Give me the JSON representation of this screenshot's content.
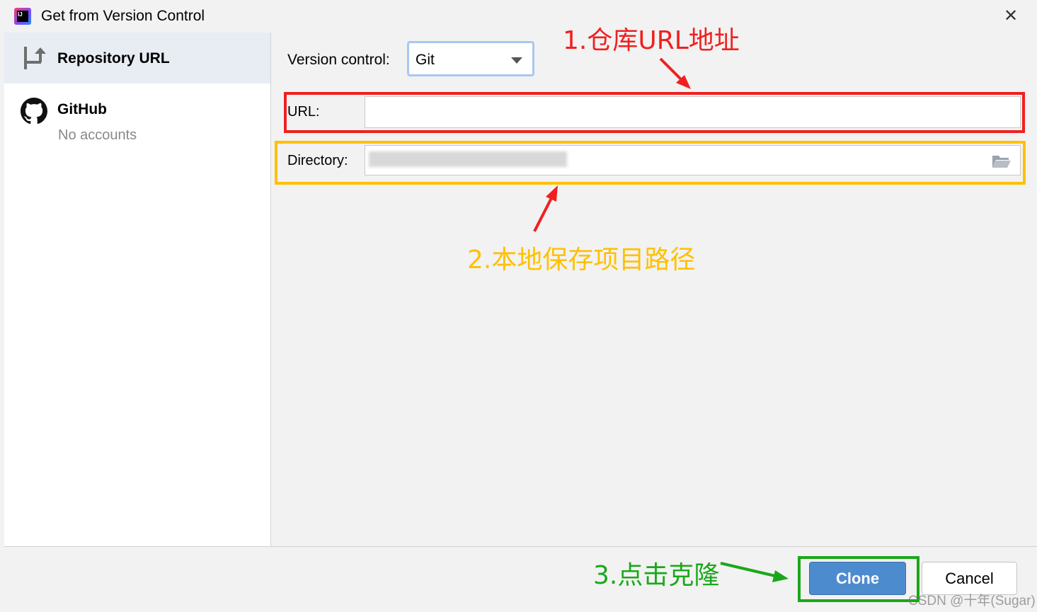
{
  "window": {
    "title": "Get from Version Control",
    "app_icon_text": "IJ"
  },
  "sidebar": {
    "items": [
      {
        "label": "Repository URL",
        "icon": "repository-url-icon",
        "selected": true
      },
      {
        "label": "GitHub",
        "icon": "github-icon",
        "sublabel": "No accounts"
      }
    ]
  },
  "form": {
    "version_control_label": "Version control:",
    "version_control_value": "Git",
    "url_label": "URL:",
    "url_value": "",
    "directory_label": "Directory:",
    "directory_value": ""
  },
  "annotations": {
    "a1": "1.仓库URL地址",
    "a2": "2.本地保存项目路径",
    "a3": "3.点击克隆"
  },
  "annotation_colors": {
    "a1": "#f02020",
    "a2": "#ffc000",
    "a3": "#1aa81a"
  },
  "buttons": {
    "clone": "Clone",
    "cancel": "Cancel"
  },
  "watermark": "CSDN @十年(Sugar)"
}
